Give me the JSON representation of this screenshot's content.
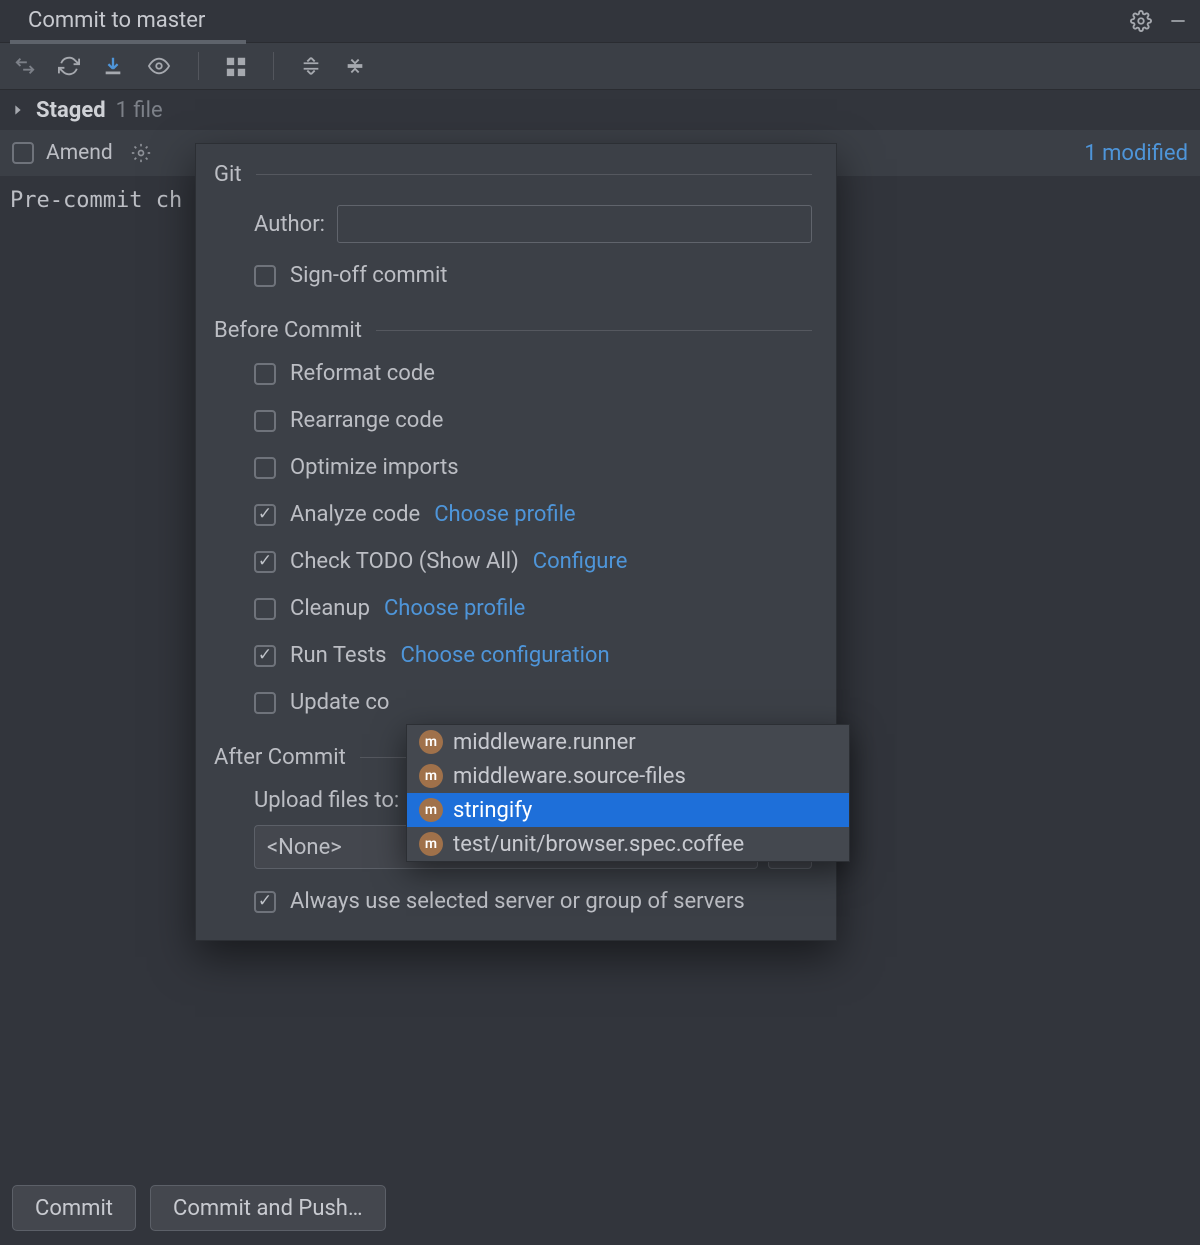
{
  "title": "Commit to master",
  "staged": {
    "label": "Staged",
    "count": "1 file"
  },
  "amend_label": "Amend",
  "modified_text": "1 modified",
  "precommit_text": "Pre-commit ch",
  "git_section": {
    "title": "Git",
    "author_label": "Author:",
    "author_value": "",
    "signoff": {
      "label": "Sign-off commit",
      "checked": false
    }
  },
  "before_section": {
    "title": "Before Commit",
    "items": [
      {
        "label": "Reformat code",
        "checked": false
      },
      {
        "label": "Rearrange code",
        "checked": false
      },
      {
        "label": "Optimize imports",
        "checked": false
      },
      {
        "label": "Analyze code",
        "checked": true,
        "link": "Choose profile"
      },
      {
        "label": "Check TODO (Show All)",
        "checked": true,
        "link": "Configure"
      },
      {
        "label": "Cleanup",
        "checked": false,
        "link": "Choose profile"
      },
      {
        "label": "Run Tests",
        "checked": true,
        "link": "Choose configuration"
      },
      {
        "label": "Update co",
        "checked": false
      }
    ]
  },
  "after_section": {
    "title": "After Commit",
    "upload_label": "Upload files to:",
    "select_value": "<None>",
    "more": "...",
    "always": {
      "label": "Always use selected server or group of servers",
      "checked": true
    }
  },
  "configs": {
    "items": [
      {
        "name": "middleware.runner",
        "selected": false
      },
      {
        "name": "middleware.source-files",
        "selected": false
      },
      {
        "name": "stringify",
        "selected": true
      },
      {
        "name": "test/unit/browser.spec.coffee",
        "selected": false
      }
    ]
  },
  "buttons": {
    "commit": "Commit",
    "commit_push": "Commit and Push…"
  }
}
